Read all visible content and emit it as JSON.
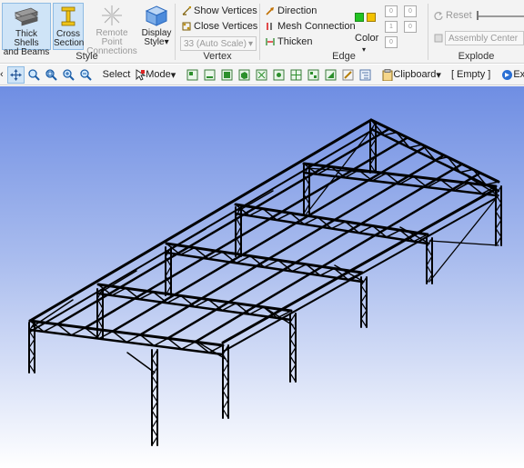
{
  "ribbon": {
    "style_group": {
      "label": "Style",
      "thick_shells_line1": "Thick Shells",
      "thick_shells_line2": "and Beams",
      "cross_section_line1": "Cross",
      "cross_section_line2": "Section",
      "remote_point_line1": "Remote Point",
      "remote_point_line2": "Connections",
      "display_style_line1": "Display",
      "display_style_line2": "Style"
    },
    "vertex_group": {
      "label": "Vertex",
      "show_vertices": "Show Vertices",
      "close_vertices": "Close Vertices",
      "scale_value": "33 (Auto Scale)"
    },
    "edge_group": {
      "label": "Edge",
      "direction": "Direction",
      "mesh_connection": "Mesh Connection",
      "thicken": "Thicken",
      "color": "Color",
      "color_green": "#22c322",
      "color_yellow": "#f3c200"
    },
    "explode_group": {
      "label": "Explode",
      "reset": "Reset",
      "assembly_center": "Assembly Center"
    }
  },
  "toolbar": {
    "select": "Select",
    "mode": "Mode",
    "clipboard": "Clipboard",
    "empty": "[ Empty ]",
    "extend": "Extend"
  },
  "viewport": {
    "background_top": "#6f8ee3",
    "background_bottom": "#ffffff",
    "model_color": "#000000"
  }
}
